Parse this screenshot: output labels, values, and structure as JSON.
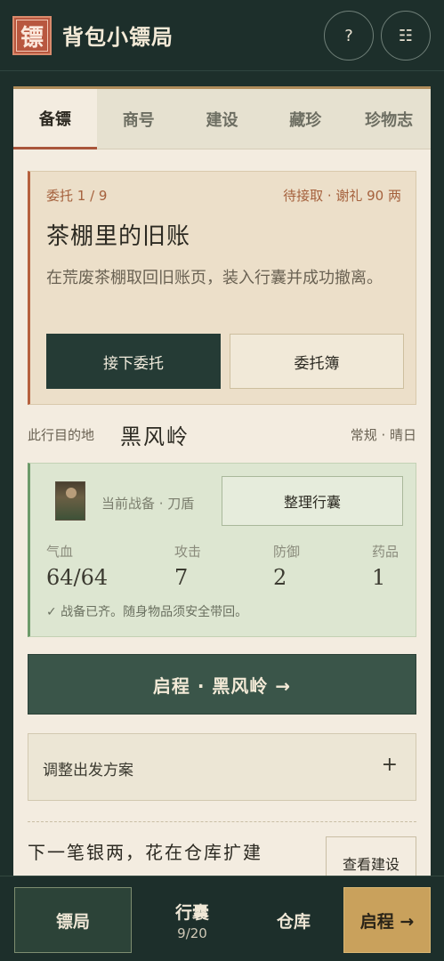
{
  "header": {
    "logo_char": "镖",
    "title": "背包小镖局",
    "help_label": "?",
    "menu_label": "☷"
  },
  "tabs": [
    {
      "label": "备镖",
      "active": true
    },
    {
      "label": "商号",
      "active": false
    },
    {
      "label": "建设",
      "active": false
    },
    {
      "label": "藏珍",
      "active": false
    },
    {
      "label": "珍物志",
      "active": false
    }
  ],
  "commission": {
    "count": "委托 1 / 9",
    "status": "待接取 · 谢礼 90 两",
    "title": "茶棚里的旧账",
    "description": "在荒废茶棚取回旧账页，装入行囊并成功撤离。",
    "accept_label": "接下委托",
    "book_label": "委托簿"
  },
  "destination": {
    "label": "此行目的地",
    "name": "黑风岭",
    "condition": "常规 · 晴日"
  },
  "gear": {
    "label": "当前战备 · 刀盾",
    "pack_button": "整理行囊",
    "stats": [
      {
        "label": "气血",
        "value": "64/64"
      },
      {
        "label": "攻击",
        "value": "7"
      },
      {
        "label": "防御",
        "value": "2"
      },
      {
        "label": "药品",
        "value": "1"
      }
    ],
    "note": "✓ 战备已齐。随身物品须安全带回。"
  },
  "depart_button": "启程 · 黑风岭 →",
  "plan": {
    "label": "调整出发方案",
    "toggle": "+"
  },
  "tip": {
    "text": "下一笔银两，花在仓库扩建",
    "button": "查看建设"
  },
  "bottom_nav": {
    "home": "镖局",
    "bag": "行囊",
    "bag_count": "9/20",
    "store": "仓库",
    "go": "启程 →"
  },
  "colors": {
    "background": "#1d2f2b",
    "card": "#f3ece0",
    "accent": "#b6613f",
    "primary_button": "#253b35",
    "gear_panel": "#dde6d1",
    "go_button": "#c9a15c"
  }
}
